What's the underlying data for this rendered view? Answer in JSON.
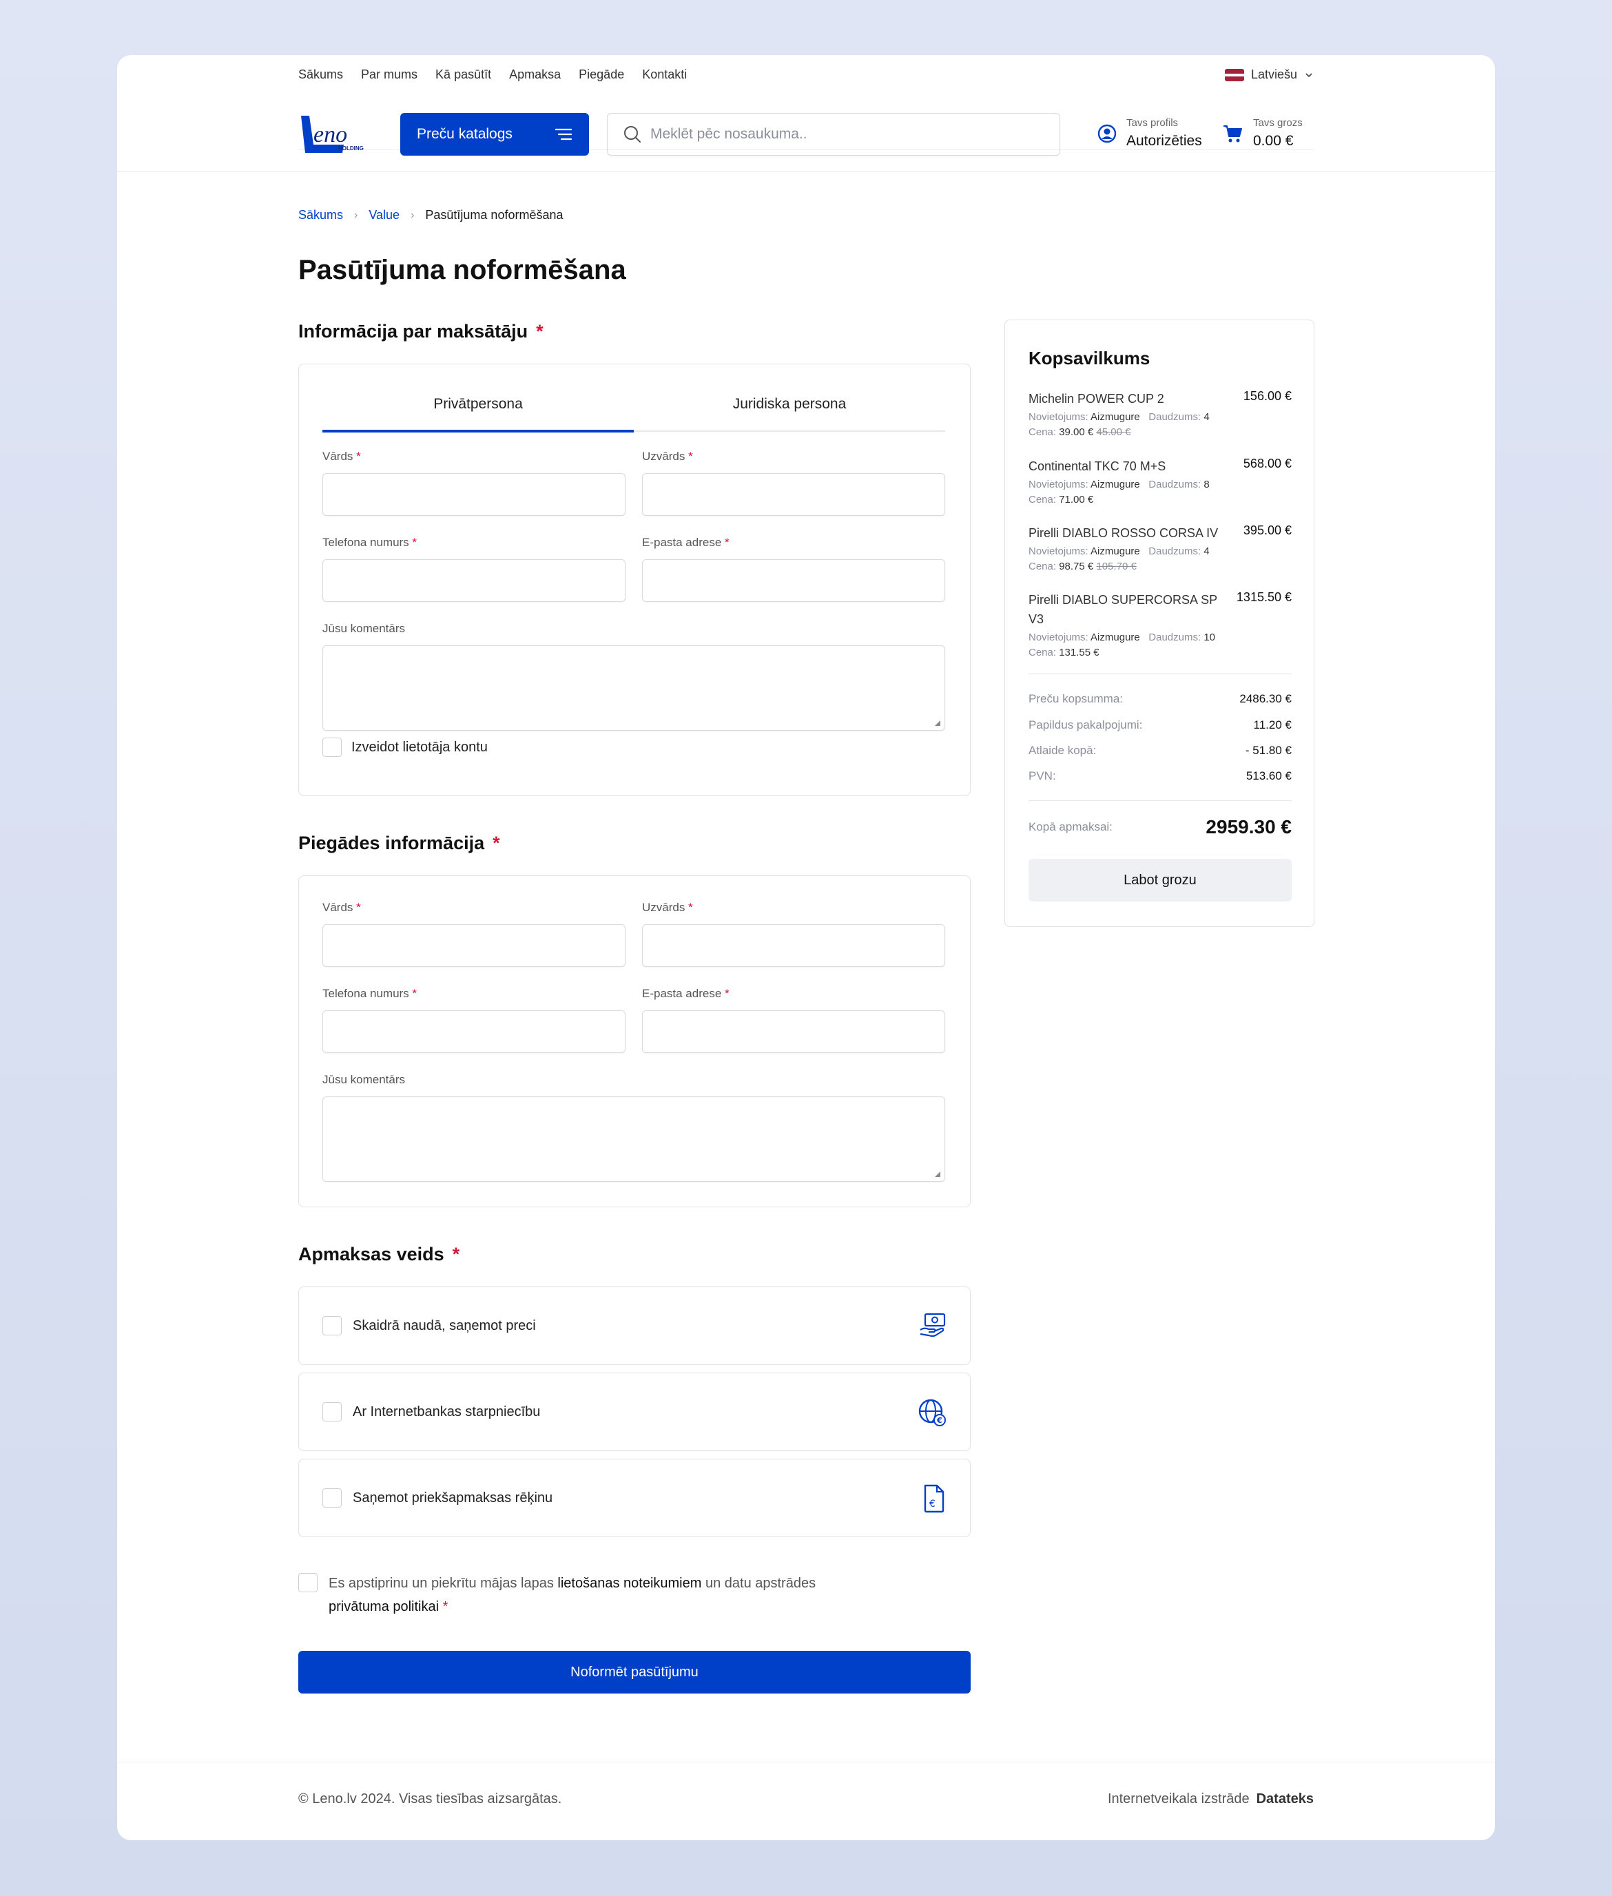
{
  "topnav": {
    "links": [
      "Sākums",
      "Par mums",
      "Kā pasūtīt",
      "Apmaksa",
      "Piegāde",
      "Kontakti"
    ],
    "language": "Latviešu"
  },
  "header": {
    "logo_text": "eno",
    "logo_sub": "HOLDING",
    "catalog_label": "Preču katalogs",
    "search_placeholder": "Meklēt pēc nosaukuma..",
    "profile_small": "Tavs profils",
    "profile_big": "Autorizēties",
    "cart_small": "Tavs grozs",
    "cart_big": "0.00 €"
  },
  "breadcrumb": [
    "Sākums",
    "Value",
    "Pasūtījuma noformēšana"
  ],
  "page_title": "Pasūtījuma noformēšana",
  "payer": {
    "title": "Informācija par maksātāju",
    "tabs": [
      "Privātpersona",
      "Juridiska persona"
    ],
    "fields": {
      "first_name": "Vārds",
      "last_name": "Uzvārds",
      "phone": "Telefona numurs",
      "email": "E-pasta adrese",
      "comment": "Jūsu komentārs"
    },
    "create_account": "Izveidot lietotāja kontu"
  },
  "delivery": {
    "title": "Piegādes informācija",
    "fields": {
      "first_name": "Vārds",
      "last_name": "Uzvārds",
      "phone": "Telefona numurs",
      "email": "E-pasta adrese",
      "comment": "Jūsu komentārs"
    }
  },
  "payment": {
    "title": "Apmaksas veids",
    "options": [
      {
        "label": "Skaidrā naudā, saņemot preci",
        "icon": "cash-hand-icon"
      },
      {
        "label": "Ar Internetbankas starpniecību",
        "icon": "globe-euro-icon"
      },
      {
        "label": "Saņemot priekšapmaksas rēķinu",
        "icon": "invoice-euro-icon"
      }
    ]
  },
  "terms": {
    "pre": "Es apstiprinu un piekrītu mājas lapas ",
    "link1": "lietošanas noteikumiem",
    "mid": " un datu apstrādes",
    "link2": "privātuma politikai"
  },
  "submit_label": "Noformēt pasūtījumu",
  "summary": {
    "title": "Kopsavilkums",
    "labels": {
      "position": "Novietojums:",
      "quantity": "Daudzums:",
      "price": "Cena:"
    },
    "items": [
      {
        "name": "Michelin POWER CUP 2",
        "total": "156.00 €",
        "position": "Aizmugure",
        "qty": "4",
        "price": "39.00 €",
        "old_price": "45.00 €"
      },
      {
        "name": "Continental TKC 70 M+S",
        "total": "568.00 €",
        "position": "Aizmugure",
        "qty": "8",
        "price": "71.00 €",
        "old_price": ""
      },
      {
        "name": "Pirelli DIABLO ROSSO CORSA IV",
        "total": "395.00 €",
        "position": "Aizmugure",
        "qty": "4",
        "price": "98.75 €",
        "old_price": "105.70 €"
      },
      {
        "name": "Pirelli DIABLO SUPERCORSA SP V3",
        "total": "1315.50 €",
        "position": "Aizmugure",
        "qty": "10",
        "price": "131.55 €",
        "old_price": ""
      }
    ],
    "totals": [
      {
        "label": "Preču kopsumma:",
        "value": "2486.30 €"
      },
      {
        "label": "Papildus pakalpojumi:",
        "value": "11.20 €"
      },
      {
        "label": "Atlaide kopā:",
        "value": "- 51.80 €"
      },
      {
        "label": "PVN:",
        "value": "513.60 €"
      }
    ],
    "grand_label": "Kopā apmaksai:",
    "grand_value": "2959.30 €",
    "edit_label": "Labot grozu"
  },
  "footer": {
    "copyright": "© Leno.lv 2024. Visas tiesības aizsargātas.",
    "developer_label": "Internetveikala izstrāde",
    "developer_name": "Datateks"
  },
  "colors": {
    "accent": "#0040c9",
    "required": "#d3163a"
  }
}
